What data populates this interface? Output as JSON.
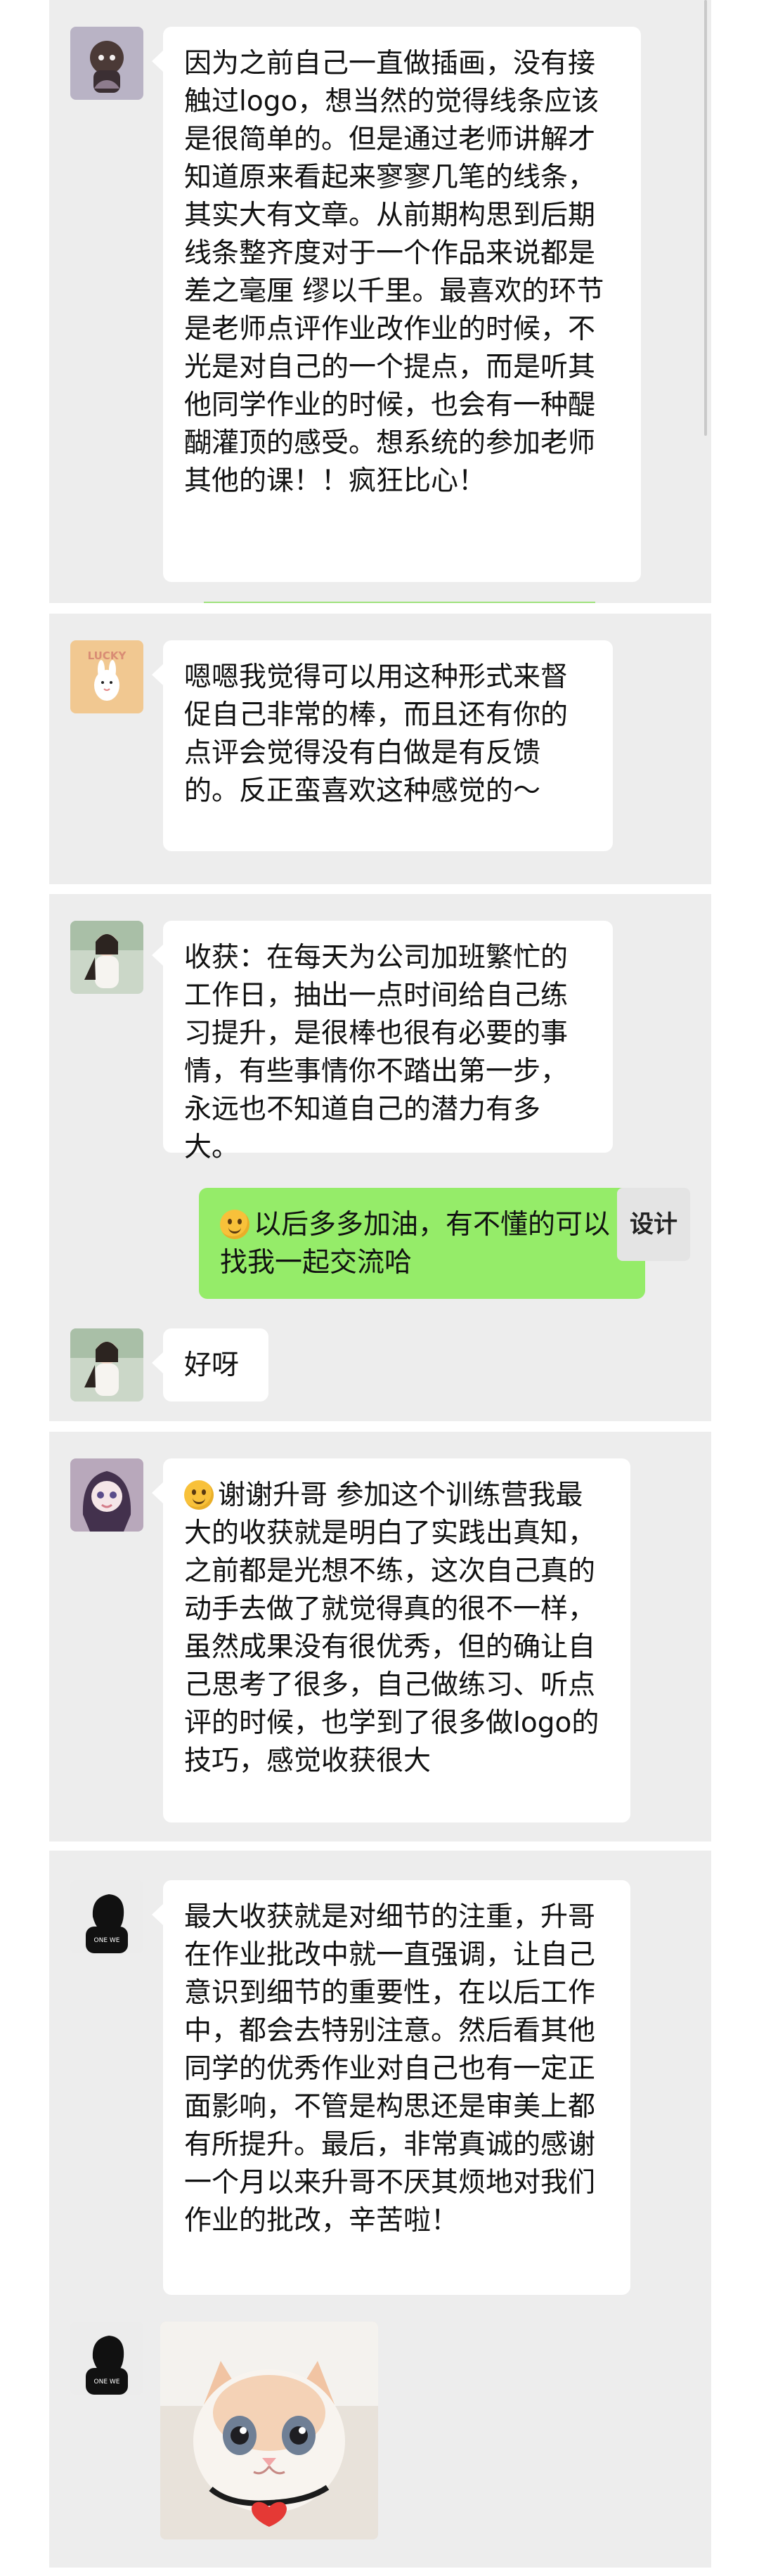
{
  "contact_badge": "设计",
  "cards": [
    {
      "messages": [
        {
          "sender": "classmate-1",
          "text": "因为之前自己一直做插画，没有接触过logo，想当然的觉得线条应该是很简单的。但是通过老师讲解才知道原来看起来寥寥几笔的线条，其实大有文章。从前期构思到后期线条整齐度对于一个作品来说都是差之毫厘 缪以千里。最喜欢的环节是老师点评作业改作业的时候，不光是对自己的一个提点，而是听其他同学作业的时候，也会有一种醍醐灌顶的感受。想系统的参加老师其他的课！！疯狂比心！"
        }
      ]
    },
    {
      "messages": [
        {
          "sender": "classmate-2",
          "avatar_text": "LUCKY",
          "text": "嗯嗯我觉得可以用这种形式来督促自己非常的棒，而且还有你的点评会觉得没有白做是有反馈的。反正蛮喜欢这种感觉的～"
        }
      ]
    },
    {
      "messages": [
        {
          "sender": "classmate-3",
          "text": "收获：在每天为公司加班繁忙的工作日，抽出一点时间给自己练习提升，是很棒也很有必要的事情，有些事情你不踏出第一步，永远也不知道自己的潜力有多大。"
        },
        {
          "sender": "me",
          "text": "以后多多加油，有不懂的可以找我一起交流哈"
        },
        {
          "sender": "classmate-3",
          "text": "好呀"
        }
      ]
    },
    {
      "messages": [
        {
          "sender": "classmate-4",
          "text": "谢谢升哥 参加这个训练营我最大的收获就是明白了实践出真知，之前都是光想不练，这次自己真的动手去做了就觉得真的很不一样，虽然成果没有很优秀，但的确让自己思考了很多，自己做练习、听点评的时候，也学到了很多做logo的技巧，感觉收获很大"
        }
      ]
    },
    {
      "messages": [
        {
          "sender": "classmate-5",
          "avatar_text": "ONE WE",
          "text": "最大收获就是对细节的注重，升哥在作业批改中就一直强调，让自己意识到细节的重要性，在以后工作中，都会去特别注意。然后看其他同学的优秀作业对自己也有一定正面影响，不管是构思还是审美上都有所提升。最后，非常真诚的感谢一个月以来升哥不厌其烦地对我们作业的批改，辛苦啦！"
        },
        {
          "sender": "classmate-5",
          "image": "cat-sticker"
        }
      ]
    }
  ]
}
